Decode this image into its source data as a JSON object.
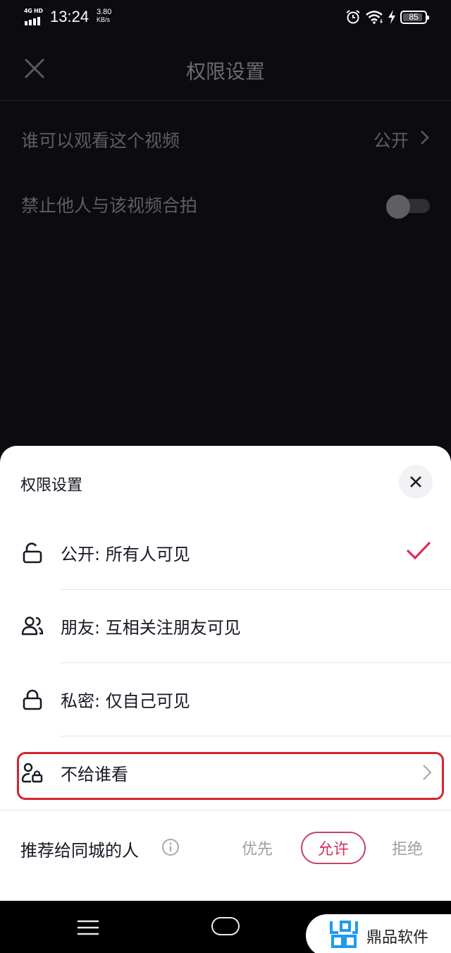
{
  "status_bar": {
    "network": "4G HD",
    "time": "13:24",
    "speed_value": "3.80",
    "speed_unit": "KB/s",
    "icons": [
      "alarm-icon",
      "wifi-icon",
      "charging-icon",
      "battery-icon"
    ],
    "battery_level": "85"
  },
  "background_page": {
    "title": "权限设置",
    "close_icon": "close-icon",
    "rows": [
      {
        "label": "谁可以观看这个视频",
        "value": "公开",
        "icon": "chevron-right-icon"
      },
      {
        "label": "禁止他人与该视频合拍",
        "toggle_on": false
      }
    ]
  },
  "sheet": {
    "title": "权限设置",
    "close_icon": "close-icon",
    "options": [
      {
        "icon": "unlock-icon",
        "label": "公开: 所有人可见",
        "selected": true
      },
      {
        "icon": "friends-icon",
        "label": "朋友: 互相关注朋友可见",
        "selected": false
      },
      {
        "icon": "lock-icon",
        "label": "私密: 仅自己可见",
        "selected": false
      },
      {
        "icon": "user-lock-icon",
        "label": "不给谁看",
        "selected": false,
        "has_chevron": true,
        "highlighted": true
      }
    ],
    "city_recommend": {
      "label": "推荐给同城的人",
      "info_icon": "info-icon",
      "choices": [
        "优先",
        "允许",
        "拒绝"
      ],
      "selected": "允许"
    }
  },
  "nav_bar": {
    "icons": [
      "menu-icon",
      "home-icon"
    ]
  },
  "watermark": {
    "text": "鼎品软件"
  },
  "colors": {
    "accent": "#d6305c",
    "highlight_box": "#d9222e",
    "watermark_logo": "#1e9bf0",
    "overlay_bg": "#0b0b10"
  }
}
